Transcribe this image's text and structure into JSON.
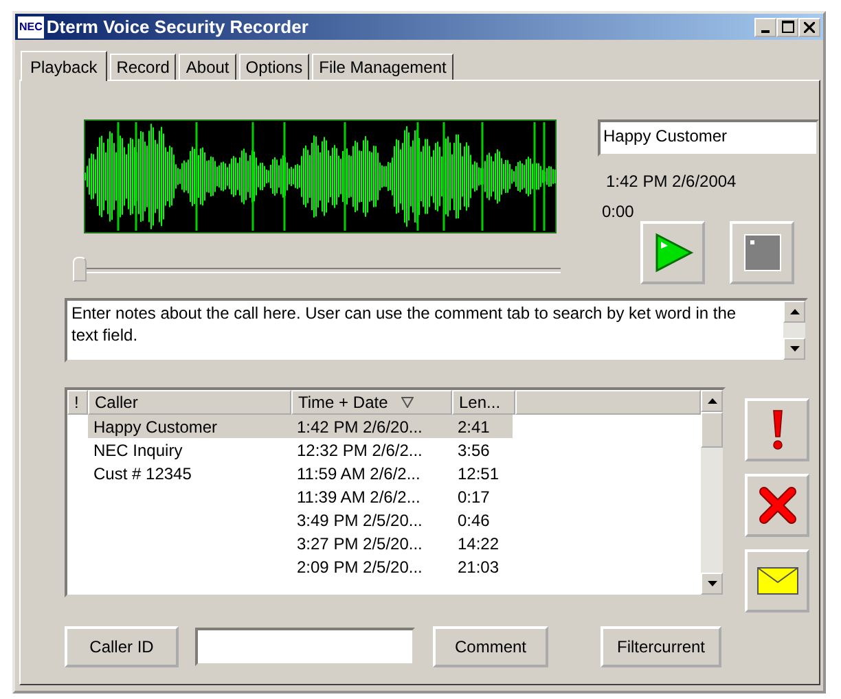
{
  "window": {
    "title": "Dterm Voice Security Recorder",
    "logo": "NEC"
  },
  "tabs": [
    {
      "label": "Playback",
      "selected": true
    },
    {
      "label": "Record",
      "selected": false
    },
    {
      "label": "About",
      "selected": false
    },
    {
      "label": "Options",
      "selected": false
    },
    {
      "label": "File Management",
      "selected": false
    }
  ],
  "player": {
    "caller_name": "Happy Customer",
    "call_time": "1:42 PM 2/6/2004",
    "position": "0:00",
    "slider": {
      "level": 0
    }
  },
  "notes": "Enter notes about the call here. User can use the comment tab to search by ket word in the text field.",
  "table": {
    "columns": [
      "!",
      "Caller",
      "Time + Date",
      "Len..."
    ],
    "rows": [
      {
        "caller": "Happy Customer",
        "time": "1:42 PM 2/6/20...",
        "length": "2:41",
        "selected": true
      },
      {
        "caller": "NEC Inquiry",
        "time": "12:32 PM 2/6/2...",
        "length": "3:56",
        "selected": false
      },
      {
        "caller": "Cust # 12345",
        "time": "11:59 AM 2/6/2...",
        "length": "12:51",
        "selected": false
      },
      {
        "time": "11:39 AM 2/6/2...",
        "length": "0:17",
        "selected": false
      },
      {
        "time": "3:49 PM 2/5/20...",
        "length": "0:46",
        "selected": false
      },
      {
        "time": "3:27 PM 2/5/20...",
        "length": "14:22",
        "selected": false
      },
      {
        "time": "2:09 PM 2/5/20...",
        "length": "21:03",
        "selected": false
      }
    ]
  },
  "bottom_buttons": [
    "Caller ID",
    "Comment",
    "Filtercurrent"
  ]
}
